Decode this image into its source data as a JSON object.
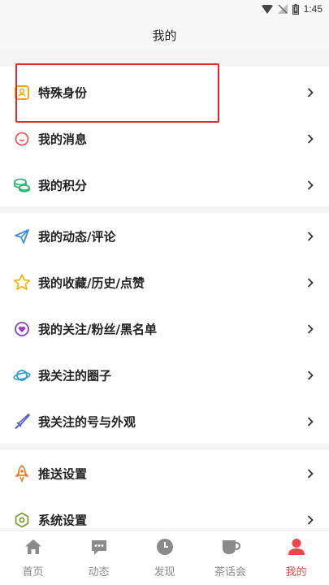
{
  "status_bar": {
    "time": "1:45"
  },
  "header": {
    "title": "我的"
  },
  "menu": {
    "special_identity": "特殊身份",
    "my_messages": "我的消息",
    "my_points": "我的积分",
    "my_posts_comments": "我的动态/评论",
    "my_favorites_history_likes": "我的收藏/历史/点赞",
    "my_follows_fans_blacklist": "我的关注/粉丝/黑名单",
    "followed_circles": "我关注的圈子",
    "followed_accounts_appearance": "我关注的号与外观",
    "push_settings": "推送设置",
    "system_settings": "系统设置"
  },
  "bottom_nav": {
    "home": "首页",
    "feed": "动态",
    "discover": "发现",
    "tea_party": "茶话会",
    "mine": "我的"
  },
  "colors": {
    "accent": "#f0454b",
    "highlight_box": "#e5282b",
    "nav_inactive": "#8a8a8a"
  }
}
